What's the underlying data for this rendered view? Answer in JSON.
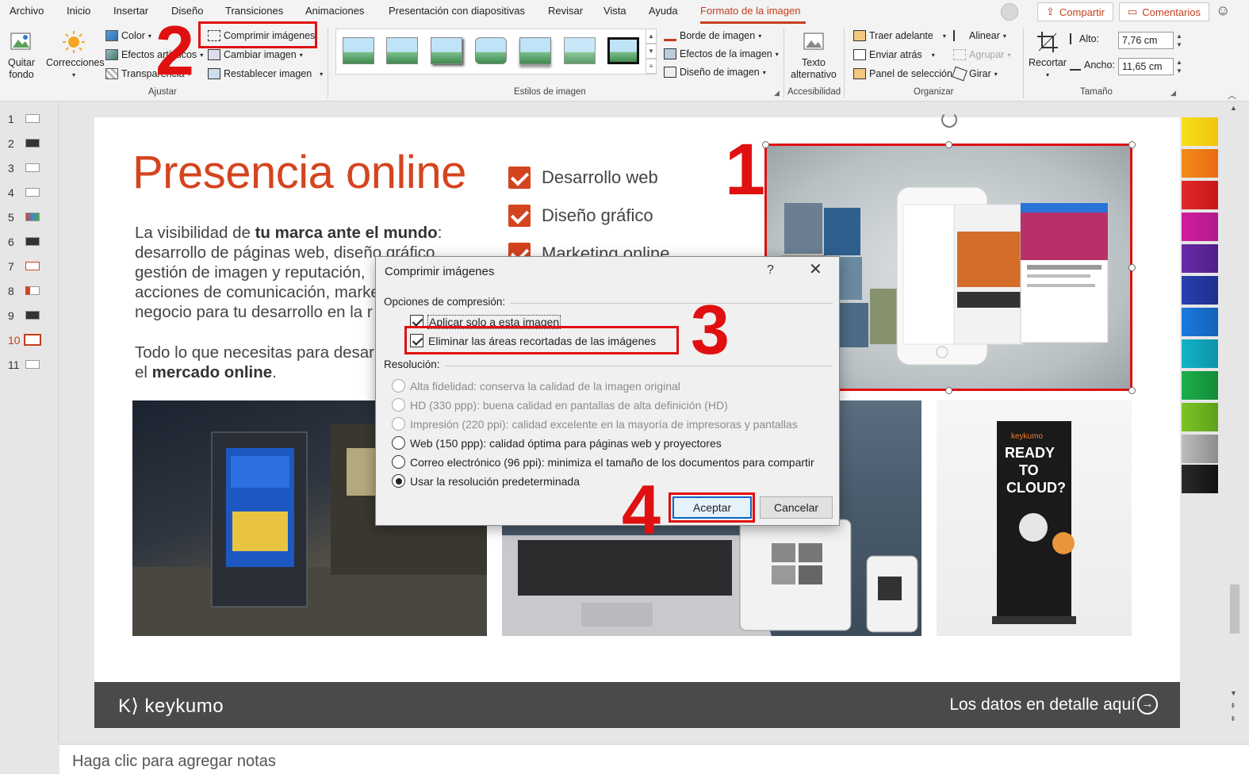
{
  "menu": {
    "items": [
      "Archivo",
      "Inicio",
      "Insertar",
      "Diseño",
      "Transiciones",
      "Animaciones",
      "Presentación con diapositivas",
      "Revisar",
      "Vista",
      "Ayuda",
      "Formato de la imagen"
    ],
    "active_index": 10,
    "share_label": "Compartir",
    "comments_label": "Comentarios",
    "accent_color": "#c43e1c"
  },
  "ribbon": {
    "ajustar": {
      "label": "Ajustar",
      "quitar_fondo": "Quitar fondo",
      "correcciones": "Correcciones",
      "color": "Color",
      "efectos_artisticos": "Efectos artísticos",
      "transparencia": "Transparencia",
      "comprimir": "Comprimir imágenes",
      "cambiar": "Cambiar imagen",
      "restablecer": "Restablecer imagen"
    },
    "estilos": {
      "label": "Estilos de imagen",
      "borde": "Borde de imagen",
      "efectos": "Efectos de la imagen",
      "diseno": "Diseño de imagen"
    },
    "accesibilidad": {
      "label": "Accesibilidad",
      "texto_alt": "Texto alternativo"
    },
    "organizar": {
      "label": "Organizar",
      "traer": "Traer adelante",
      "enviar": "Enviar atrás",
      "panel": "Panel de selección",
      "alinear": "Alinear",
      "agrupar": "Agrupar",
      "girar": "Girar"
    },
    "tamano": {
      "label": "Tamaño",
      "recortar": "Recortar",
      "alto_label": "Alto:",
      "alto_value": "7,76 cm",
      "ancho_label": "Ancho:",
      "ancho_value": "11,65 cm"
    }
  },
  "thumbnails": [
    "1",
    "2",
    "3",
    "4",
    "5",
    "6",
    "7",
    "8",
    "9",
    "10",
    "11"
  ],
  "active_slide": 10,
  "slide": {
    "title": "Presencia online",
    "para1_line1_pre": "La visibilidad de ",
    "para1_line1_bold": "tu marca ante el mundo",
    "para1_line1_post": ":",
    "para1_line2": "desarrollo de páginas web, diseño gráfico,",
    "para1_line3": "gestión de imagen y reputación,",
    "para1_line4": "acciones de comunicación, marke",
    "para1_line5": "negocio para tu desarrollo en la r",
    "para2_line1": "Todo lo que necesitas para desar",
    "para2_line2_pre": "el ",
    "para2_line2_bold": "mercado online",
    "para2_line2_post": ".",
    "checklist": [
      "Desarrollo web",
      "Diseño gráfico",
      "Marketing online"
    ],
    "footer_logo": "K⟩ keykumo",
    "footer_link": "Los datos en detalle aquí",
    "accent_color": "#d4441e"
  },
  "notes": {
    "placeholder": "Haga clic para agregar notas"
  },
  "dialog": {
    "title": "Comprimir imágenes",
    "help": "?",
    "section_compress": "Opciones de compresión:",
    "opt_apply_only": "Aplicar solo a esta imagen",
    "opt_apply_only_checked": true,
    "opt_delete_cropped": "Eliminar las áreas recortadas de las imágenes",
    "opt_delete_cropped_checked": true,
    "section_resolution": "Resolución:",
    "resolutions": [
      {
        "label": "Alta fidelidad: conserva la calidad de la imagen original",
        "enabled": false
      },
      {
        "label": "HD (330 ppp): buena calidad en pantallas de alta definición (HD)",
        "enabled": false
      },
      {
        "label": "Impresión (220 ppi): calidad excelente en la mayoría de impresoras y pantallas",
        "enabled": false
      },
      {
        "label": "Web (150 ppp): calidad óptima para páginas web y proyectores",
        "enabled": true
      },
      {
        "label": "Correo electrónico (96 ppi): minimiza el tamaño de los documentos para compartir",
        "enabled": true
      },
      {
        "label": "Usar la resolución predeterminada",
        "enabled": true,
        "selected": true
      }
    ],
    "ok_label": "Aceptar",
    "cancel_label": "Cancelar"
  },
  "annotations": {
    "step1": "1",
    "step2": "2",
    "step3": "3",
    "step4": "4",
    "color": "#e01010"
  }
}
